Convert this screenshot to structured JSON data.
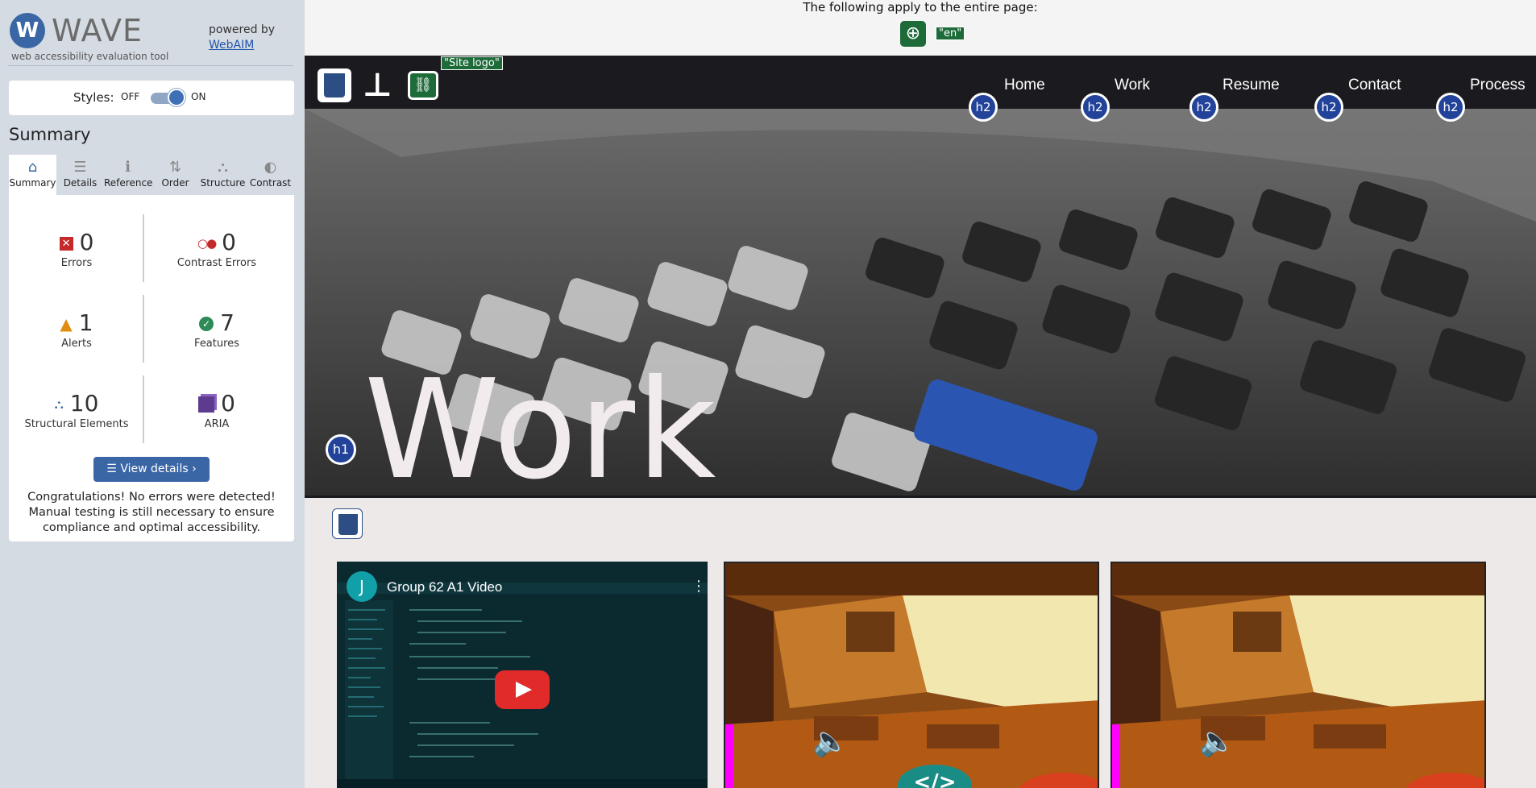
{
  "wave": {
    "logo_letter": "W",
    "title": "WAVE",
    "subtitle": "web accessibility evaluation tool",
    "powered_by": "powered by",
    "webaim_link": "WebAIM",
    "styles_label": "Styles:",
    "styles_off": "OFF",
    "styles_on": "ON",
    "summary_heading": "Summary",
    "tabs": [
      {
        "label": "Summary",
        "icon": "home-icon",
        "glyph": "⌂"
      },
      {
        "label": "Details",
        "icon": "list-icon",
        "glyph": "☰"
      },
      {
        "label": "Reference",
        "icon": "info-icon",
        "glyph": "ℹ"
      },
      {
        "label": "Order",
        "icon": "order-icon",
        "glyph": "⇅"
      },
      {
        "label": "Structure",
        "icon": "structure-icon",
        "glyph": "⛬"
      },
      {
        "label": "Contrast",
        "icon": "contrast-icon",
        "glyph": "◐"
      }
    ],
    "stats": {
      "errors": {
        "value": "0",
        "label": "Errors"
      },
      "contrast_errors": {
        "value": "0",
        "label": "Contrast Errors"
      },
      "alerts": {
        "value": "1",
        "label": "Alerts"
      },
      "features": {
        "value": "7",
        "label": "Features"
      },
      "structural": {
        "value": "10",
        "label": "Structural Elements"
      },
      "aria": {
        "value": "0",
        "label": "ARIA"
      }
    },
    "view_details": "View details ›",
    "congrats": "Congratulations! No errors were detected! Manual testing is still necessary to ensure compliance and optimal accessibility."
  },
  "page": {
    "notice": "The following apply to the entire page:",
    "lang_tag": "\"en\"",
    "site_logo_tag": "\"Site logo\"",
    "nav": [
      "Home",
      "Work",
      "Resume",
      "Contact",
      "Process"
    ],
    "h2_badge": "h2",
    "h1_badge": "h1",
    "hero_title": "Work",
    "video": {
      "avatar": "J",
      "title": "Group 62 A1 Video"
    },
    "code_badge": "</>"
  },
  "colors": {
    "wave_blue": "#3b66a6",
    "sidebar_bg": "#d5dbe3",
    "feature_green": "#1e6b3a",
    "badge_blue": "#23439a",
    "error_red": "#c42a2a"
  }
}
